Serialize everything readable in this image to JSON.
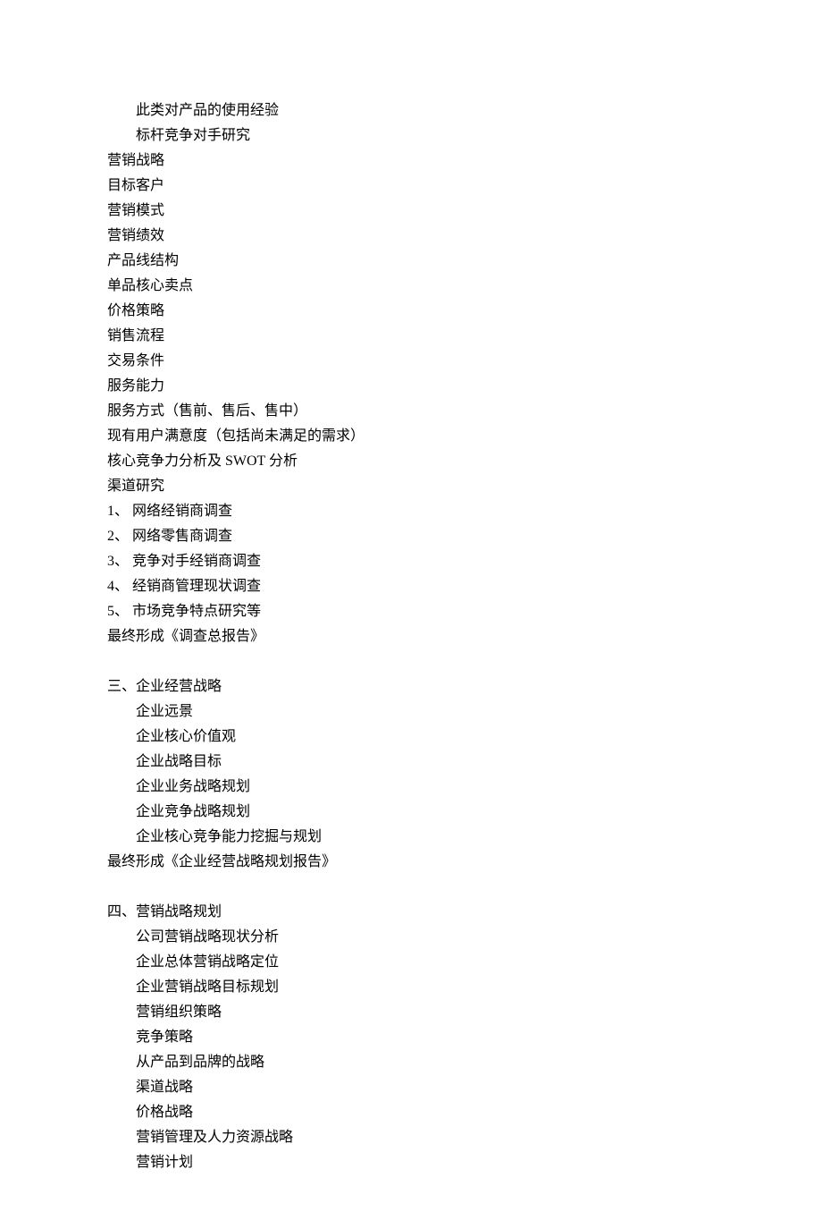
{
  "lines": [
    {
      "type": "bullet",
      "marker": "",
      "text": "此类对产品的使用经验"
    },
    {
      "type": "bullet",
      "marker": "",
      "text": "标杆竞争对手研究"
    },
    {
      "type": "plain",
      "text": "营销战略"
    },
    {
      "type": "plain",
      "text": "目标客户"
    },
    {
      "type": "plain",
      "text": "营销模式"
    },
    {
      "type": "plain",
      "text": "营销绩效"
    },
    {
      "type": "plain",
      "text": "产品线结构"
    },
    {
      "type": "plain",
      "text": "单品核心卖点"
    },
    {
      "type": "plain",
      "text": "价格策略"
    },
    {
      "type": "plain",
      "text": "销售流程"
    },
    {
      "type": "plain",
      "text": "交易条件"
    },
    {
      "type": "plain",
      "text": "服务能力"
    },
    {
      "type": "plain",
      "text": "服务方式（售前、售后、售中）"
    },
    {
      "type": "plain",
      "text": "现有用户满意度（包括尚未满足的需求）"
    },
    {
      "type": "plain",
      "text": "核心竞争力分析及 SWOT 分析"
    },
    {
      "type": "plain",
      "text": ""
    },
    {
      "type": "plain",
      "text": "渠道研究"
    },
    {
      "type": "plain",
      "text": "1、 网络经销商调查"
    },
    {
      "type": "plain",
      "text": "2、 网络零售商调查"
    },
    {
      "type": "plain",
      "text": "3、 竞争对手经销商调查"
    },
    {
      "type": "plain",
      "text": "4、 经销商管理现状调查"
    },
    {
      "type": "plain",
      "text": "5、 市场竞争特点研究等"
    },
    {
      "type": "plain",
      "text": "最终形成《调查总报告》"
    },
    {
      "type": "blank"
    },
    {
      "type": "plain",
      "text": "三、企业经营战略"
    },
    {
      "type": "bullet",
      "marker": "",
      "text": "企业远景"
    },
    {
      "type": "bullet",
      "marker": "",
      "text": "企业核心价值观"
    },
    {
      "type": "bullet",
      "marker": "",
      "text": "企业战略目标"
    },
    {
      "type": "bullet",
      "marker": "",
      "text": "企业业务战略规划"
    },
    {
      "type": "bullet",
      "marker": "",
      "text": "企业竞争战略规划"
    },
    {
      "type": "bullet",
      "marker": "",
      "text": "企业核心竞争能力挖掘与规划"
    },
    {
      "type": "plain",
      "text": "最终形成《企业经营战略规划报告》"
    },
    {
      "type": "blank"
    },
    {
      "type": "plain",
      "text": "四、营销战略规划"
    },
    {
      "type": "bullet",
      "marker": "",
      "text": "公司营销战略现状分析"
    },
    {
      "type": "bullet",
      "marker": "",
      "text": "企业总体营销战略定位"
    },
    {
      "type": "bullet",
      "marker": "",
      "text": "企业营销战略目标规划"
    },
    {
      "type": "bullet",
      "marker": "",
      "text": "营销组织策略"
    },
    {
      "type": "bullet",
      "marker": "",
      "text": "竞争策略"
    },
    {
      "type": "bullet",
      "marker": "",
      "text": "从产品到品牌的战略"
    },
    {
      "type": "bullet",
      "marker": "",
      "text": "渠道战略"
    },
    {
      "type": "bullet",
      "marker": "",
      "text": "价格战略"
    },
    {
      "type": "bullet",
      "marker": "",
      "text": "营销管理及人力资源战略"
    },
    {
      "type": "bullet",
      "marker": "",
      "text": "营销计划"
    }
  ]
}
